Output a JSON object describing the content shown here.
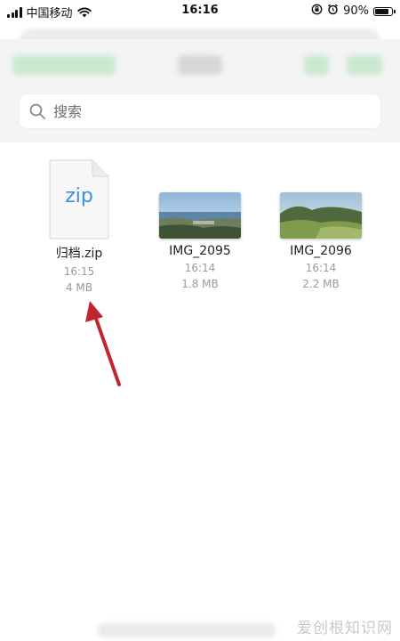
{
  "status_bar": {
    "carrier": "中国移动",
    "time": "16:16",
    "battery_percent": "90%",
    "battery_level": 0.9
  },
  "search": {
    "placeholder": "搜索"
  },
  "files": [
    {
      "name": "归档.zip",
      "time": "16:15",
      "size": "4 MB",
      "thumb_label": "zip",
      "icon": "zip-file-icon"
    },
    {
      "name": "IMG_2095",
      "time": "16:14",
      "size": "1.8 MB",
      "icon": "photo-thumbnail"
    },
    {
      "name": "IMG_2096",
      "time": "16:14",
      "size": "2.2 MB",
      "icon": "photo-thumbnail"
    }
  ],
  "watermark": "爱创根知识网",
  "colors": {
    "accent_green": "#2fa84f",
    "zip_blue": "#3d8fe0",
    "annotation_red": "#c0272d"
  }
}
